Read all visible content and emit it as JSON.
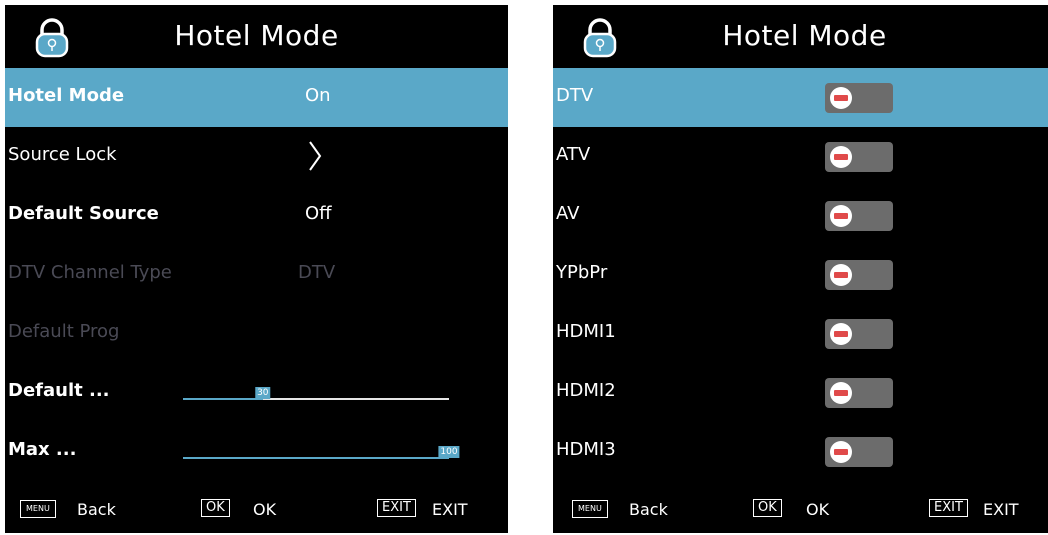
{
  "left_panel": {
    "title": "Hotel Mode",
    "rows": [
      {
        "label": "Hotel Mode",
        "value": "On"
      },
      {
        "label": "Source Lock",
        "value": ""
      },
      {
        "label": "Default Source",
        "value": "Off"
      },
      {
        "label": "DTV Channel Type",
        "value": "DTV"
      },
      {
        "label": "Default Prog",
        "value": ""
      },
      {
        "label": "Default ...",
        "slider_value": "30",
        "level": 0.3
      },
      {
        "label": "Max ...",
        "slider_value": "100",
        "level": 1.0
      }
    ],
    "footer": {
      "menu_key": "MENU",
      "back_label": "Back",
      "ok_key": "OK",
      "ok_label": "OK",
      "exit_key": "EXIT",
      "exit_label": "EXIT"
    }
  },
  "right_panel": {
    "title": "Hotel Mode",
    "sources": [
      {
        "label": "DTV"
      },
      {
        "label": "ATV"
      },
      {
        "label": "AV"
      },
      {
        "label": "YPbPr"
      },
      {
        "label": "HDMI1"
      },
      {
        "label": "HDMI2"
      },
      {
        "label": "HDMI3"
      }
    ],
    "footer": {
      "menu_key": "MENU",
      "back_label": "Back",
      "ok_key": "OK",
      "ok_label": "OK",
      "exit_key": "EXIT",
      "exit_label": "EXIT"
    }
  },
  "colors": {
    "highlight": "#5aa8c8",
    "background": "#000000",
    "disabled_text": "#4a4a55",
    "toggle_off": "#6c6c6c",
    "toggle_minus": "#e04a4a"
  }
}
